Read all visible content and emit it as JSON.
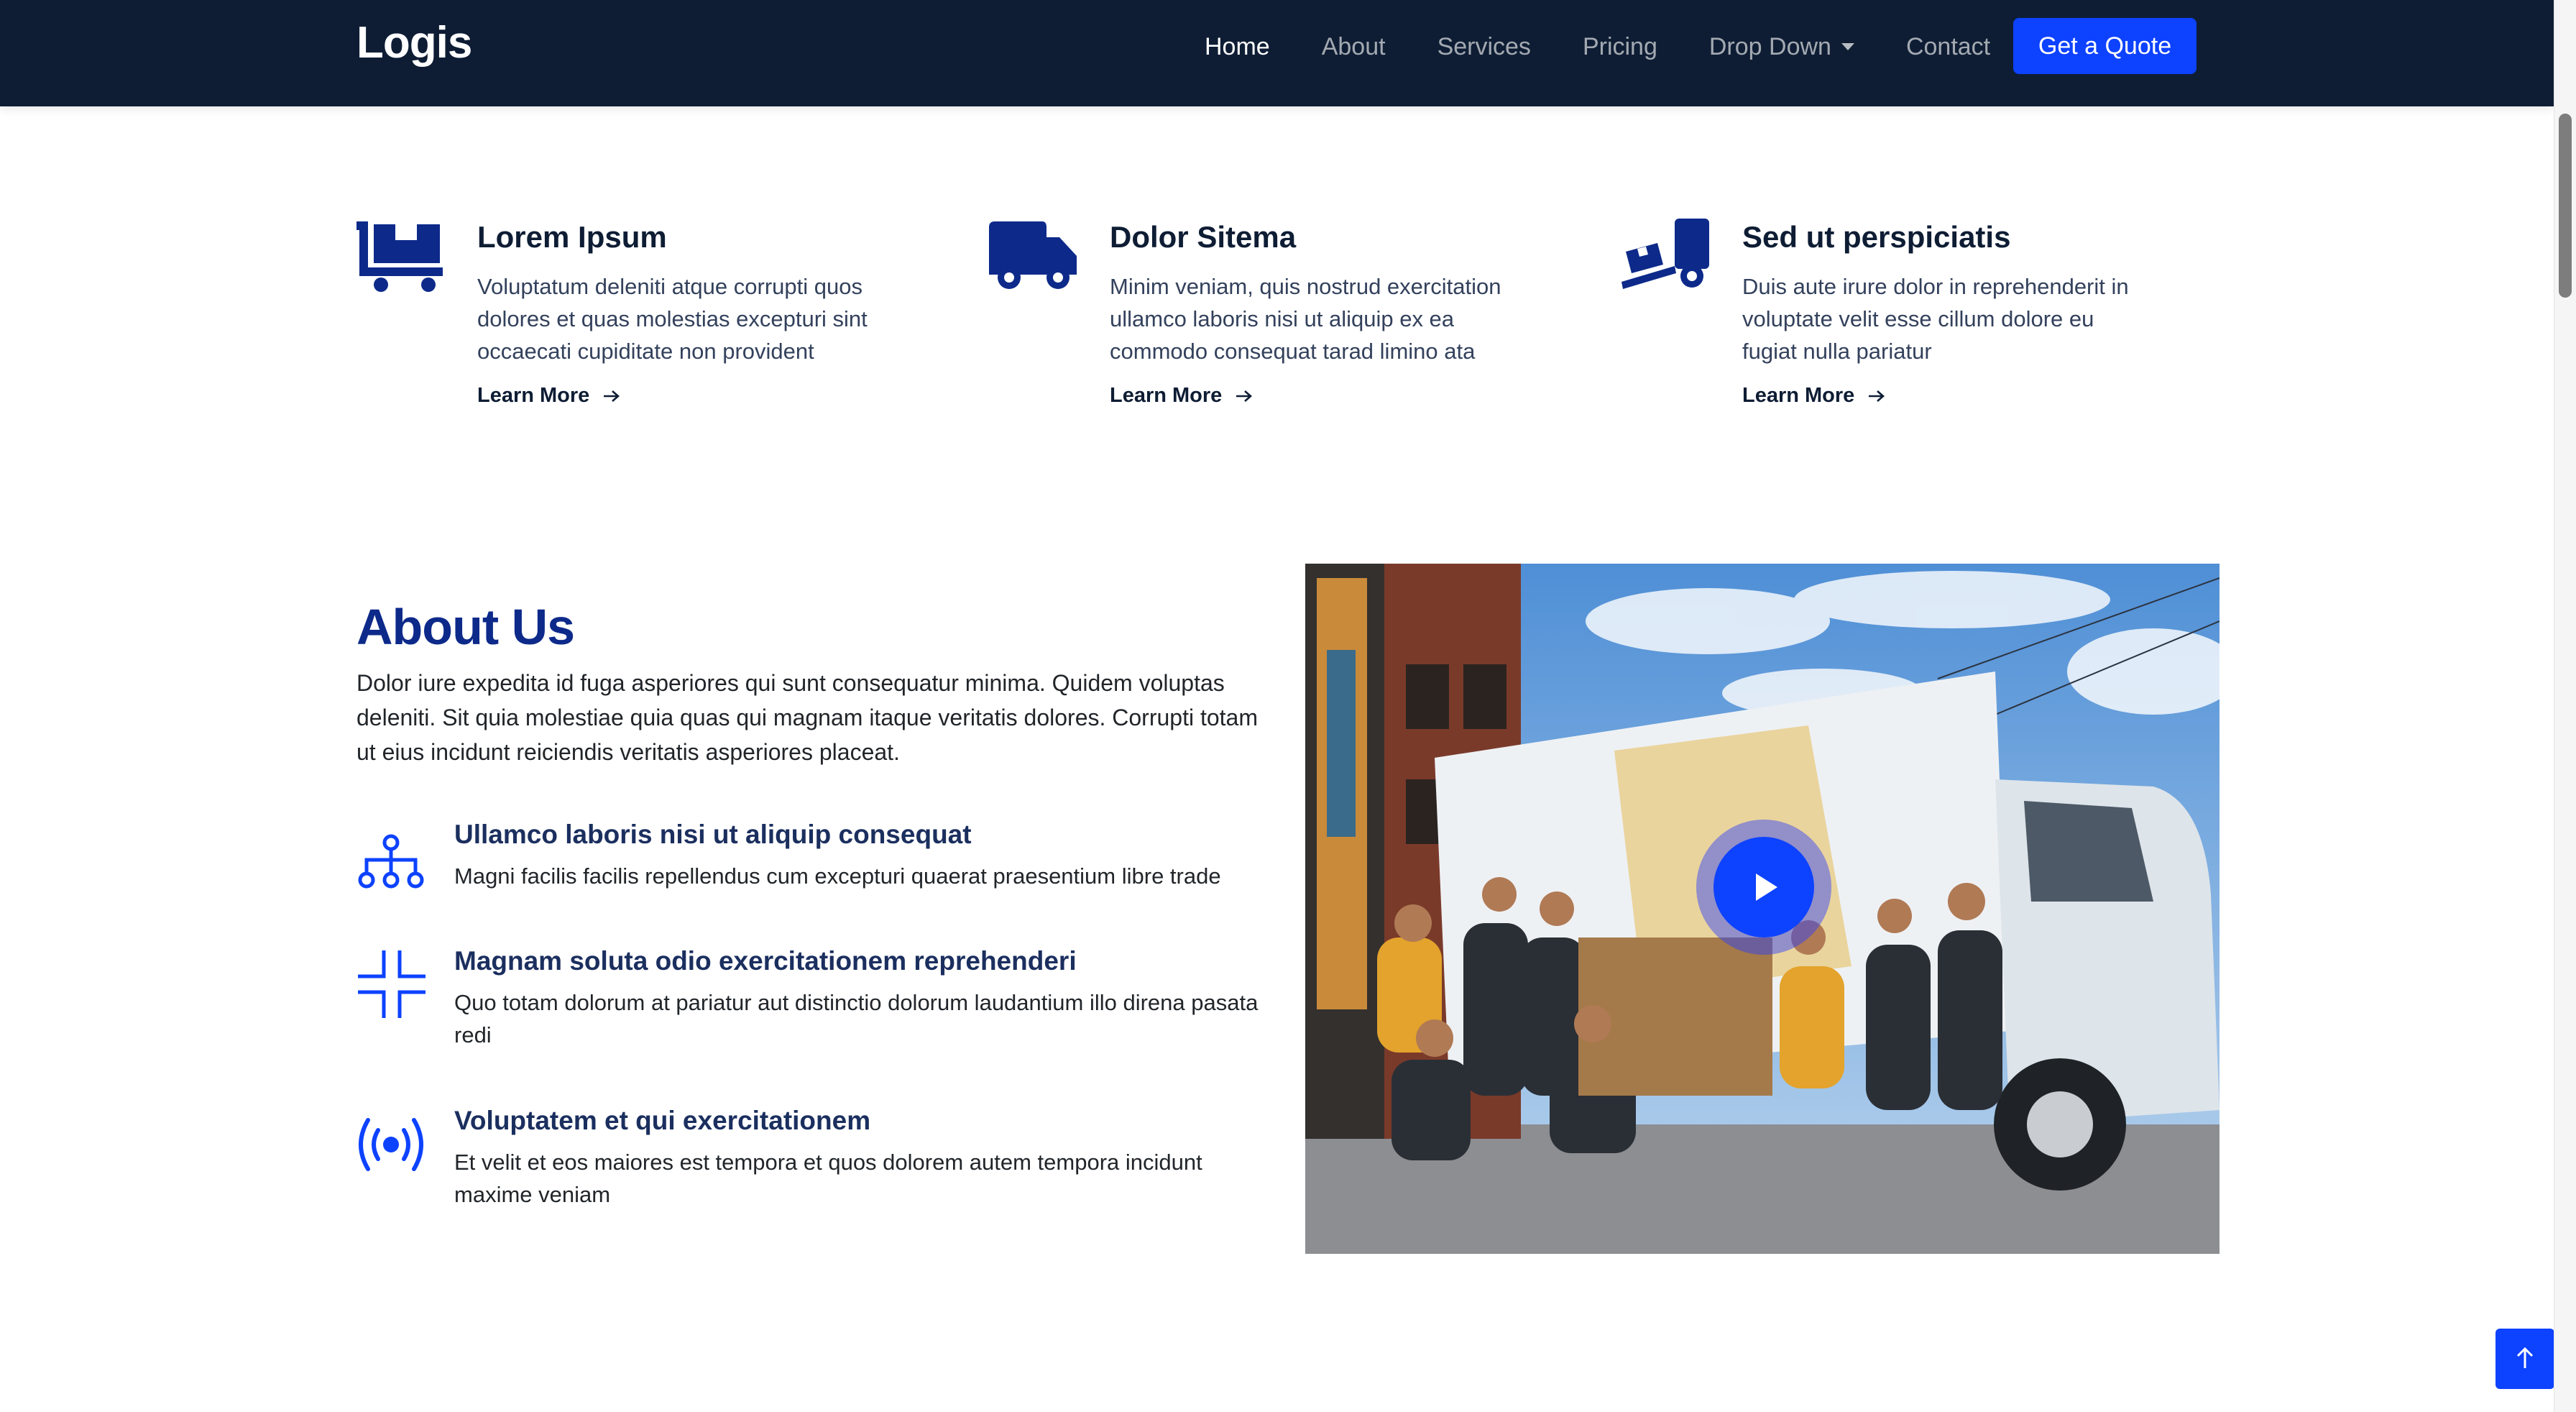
{
  "header": {
    "logo": "Logis",
    "nav": [
      {
        "label": "Home",
        "active": true
      },
      {
        "label": "About"
      },
      {
        "label": "Services"
      },
      {
        "label": "Pricing"
      },
      {
        "label": "Drop Down",
        "dropdown": true
      },
      {
        "label": "Contact"
      }
    ],
    "cta": "Get a Quote"
  },
  "features": [
    {
      "icon": "cart-flatbed-boxes-icon",
      "title": "Lorem Ipsum",
      "desc": "Voluptatum deleniti atque corrupti quos dolores et quas molestias excepturi sint occaecati cupiditate non provident",
      "link": "Learn More"
    },
    {
      "icon": "truck-icon",
      "title": "Dolor Sitema",
      "desc": "Minim veniam, quis nostrud exercitation ullamco laboris nisi ut aliquip ex ea commodo consequat tarad limino ata",
      "link": "Learn More"
    },
    {
      "icon": "truck-ramp-box-icon",
      "title": "Sed ut perspiciatis",
      "desc": "Duis aute irure dolor in reprehenderit in voluptate velit esse cillum dolore eu fugiat nulla pariatur",
      "link": "Learn More"
    }
  ],
  "about": {
    "title": "About Us",
    "text": "Dolor iure expedita id fuga asperiores qui sunt consequatur minima. Quidem voluptas deleniti. Sit quia molestiae quia quas qui magnam itaque veritatis dolores. Corrupti totam ut eius incidunt reiciendis veritatis asperiores placeat.",
    "items": [
      {
        "icon": "diagram-network-icon",
        "title": "Ullamco laboris nisi ut aliquip consequat",
        "desc": "Magni facilis facilis repellendus cum excepturi quaerat praesentium libre trade"
      },
      {
        "icon": "fullscreen-exit-icon",
        "title": "Magnam soluta odio exercitationem reprehenderi",
        "desc": "Quo totam dolorum at pariatur aut distinctio dolorum laudantium illo direna pasata redi"
      },
      {
        "icon": "broadcast-icon",
        "title": "Voluptatem et qui exercitationem",
        "desc": "Et velit et eos maiores est tempora et quos dolorem autem tempora incidunt maxime veniam"
      }
    ],
    "video_icon": "play-icon"
  },
  "colors": {
    "navy": "#0e1d34",
    "accent": "#0d42ff",
    "heading": "#0d2a8a"
  }
}
